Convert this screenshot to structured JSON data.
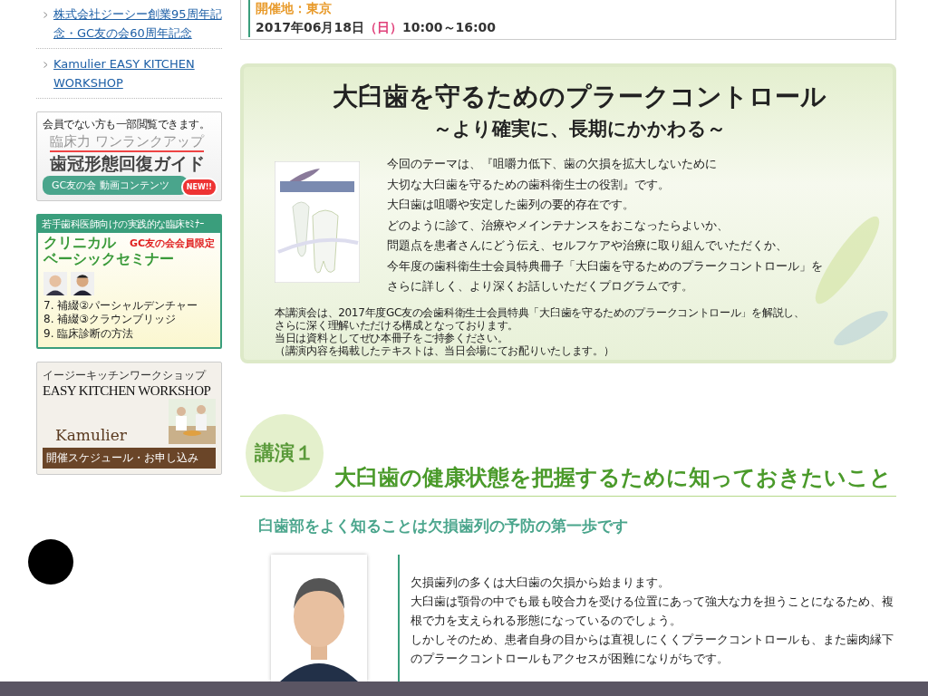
{
  "sidebar": {
    "links": [
      {
        "label": "株式会社ジーシー創業95周年記念・GC友の会60周年記念"
      },
      {
        "label": "Kamulier EASY KITCHEN WORKSHOP"
      }
    ],
    "banners": [
      {
        "kind": "video",
        "note": "会員でない方も一部閲覧できます。",
        "kicker": "臨床力 ワンランクアップ",
        "title": "歯冠形態回復ガイド",
        "ribbon": "GC友の会 動画コンテンツ",
        "badge": "NEW!!"
      },
      {
        "kind": "seminar",
        "header": "若手歯科医師向けの実践的な臨床ｾﾐﾅｰ",
        "title": [
          "クリニカル",
          "ベーシックセミナー"
        ],
        "tag": "GC友の会会員限定",
        "items": [
          "7. 補綴②パーシャルデンチャー",
          "8. 補綴③クラウンブリッジ",
          "9. 臨床診断の方法"
        ]
      },
      {
        "kind": "kitchen",
        "kicker": "イージーキッチンワークショップ",
        "title": "EASY KITCHEN WORKSHOP",
        "brand": "Kamulier",
        "button": "開催スケジュール・お申し込み"
      }
    ]
  },
  "event": {
    "venue": "開催地：東京",
    "date": "2017年06月18日",
    "weekday": "（日）",
    "time": "10:00～16:00"
  },
  "feature": {
    "title": "大臼歯を守るためのプラークコントロール",
    "subtitle": "～より確実に、長期にかかわる～",
    "intro": [
      "今回のテーマは、『咀嚼力低下、歯の欠損を拡大しないために",
      "大切な大臼歯を守るための歯科衛生士の役割』です。",
      "大臼歯は咀嚼や安定した歯列の要的存在です。",
      "どのように診て、治療やメインテナンスをおこなったらよいか、",
      "問題点を患者さんにどう伝え、セルフケアや治療に取り組んでいただくか、",
      "今年度の歯科衛生士会員特典冊子「大臼歯を守るためのプラークコントロール」を",
      "さらに詳しく、より深くお話しいただくプログラムです。"
    ],
    "note": [
      "本講演会は、2017年度GC友の会歯科衛生士会員特典「大臼歯を守るためのプラークコントロール」を解説し、",
      "さらに深く理解いただける構成となっております。",
      "当日は資料としてぜひ本冊子をご持参ください。",
      "（講演内容を掲載したテキストは、当日会場にてお配りいたします。）"
    ]
  },
  "lecture": {
    "number": "講演１",
    "title": "大臼歯の健康状態を把握するために知っておきたいこと",
    "subtitle": "臼歯部をよく知ることは欠損歯列の予防の第一歩です",
    "body": [
      "欠損歯列の多くは大臼歯の欠損から始まります。",
      "大臼歯は顎骨の中でも最も咬合力を受ける位置にあって強大な力を担うことになるため、複根で力を支えられる形態になっているのでしょう。",
      "しかしそのため、患者自身の目からは直視しにくくプラークコントロールも、また歯肉縁下のプラークコントロールもアクセスが困難になりがちです。"
    ]
  }
}
